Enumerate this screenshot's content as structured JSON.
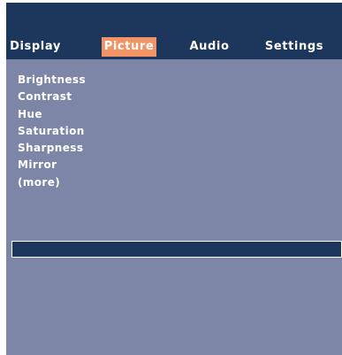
{
  "tabs": [
    {
      "label": "Display",
      "active": false
    },
    {
      "label": "Picture",
      "active": true
    },
    {
      "label": "Audio",
      "active": false
    },
    {
      "label": "Settings",
      "active": false
    }
  ],
  "menu": {
    "items": [
      {
        "label": "Brightness"
      },
      {
        "label": "Contrast"
      },
      {
        "label": "Hue"
      },
      {
        "label": "Saturation"
      },
      {
        "label": "Sharpness"
      },
      {
        "label": "Mirror"
      },
      {
        "label": "(more)"
      }
    ]
  },
  "value_bar": {
    "text": ""
  },
  "colors": {
    "header_bg": "#1d365c",
    "panel_bg": "#7d86a6",
    "active_tab_bg": "#f09466",
    "text": "#ffffff"
  }
}
